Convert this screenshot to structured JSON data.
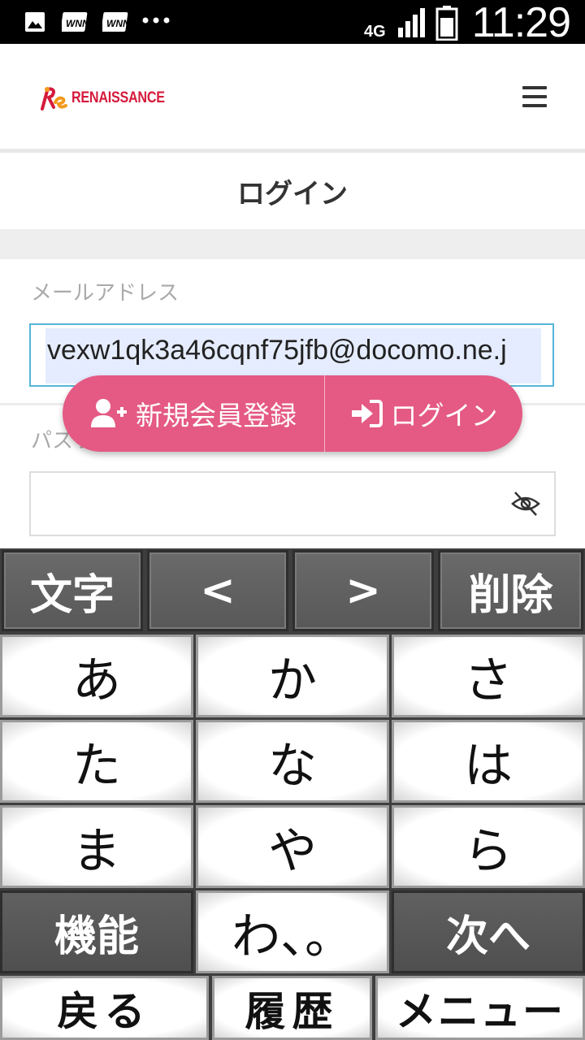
{
  "status_bar": {
    "network": "4G",
    "time": "11:29",
    "notification_icons": [
      "image-icon",
      "wnn-icon",
      "wnn-icon",
      "more-dots-icon"
    ]
  },
  "header": {
    "logo_text": "RENAISSANCE",
    "menu_icon": "hamburger-icon"
  },
  "page": {
    "title": "ログイン"
  },
  "form": {
    "email_label": "メールアドレス",
    "email_value": "vexw1qk3a46cqnf75jfb@docomo.ne.j",
    "password_label": "パスワード",
    "password_value": ""
  },
  "fab": {
    "register_label": "新規会員登録",
    "login_label": "ログイン"
  },
  "keyboard": {
    "top_row": [
      "文字",
      "<",
      ">",
      "削除"
    ],
    "rows": [
      [
        "あ",
        "か",
        "さ"
      ],
      [
        "た",
        "な",
        "は"
      ],
      [
        "ま",
        "や",
        "ら"
      ],
      [
        "機能",
        "わ、。",
        "次へ"
      ]
    ],
    "bottom_row": [
      "戻る",
      "履歴",
      "メニュー"
    ]
  },
  "colors": {
    "accent_pink": "#e45a84",
    "brand_red": "#d51a3c",
    "focus_border": "#55b6d8"
  }
}
